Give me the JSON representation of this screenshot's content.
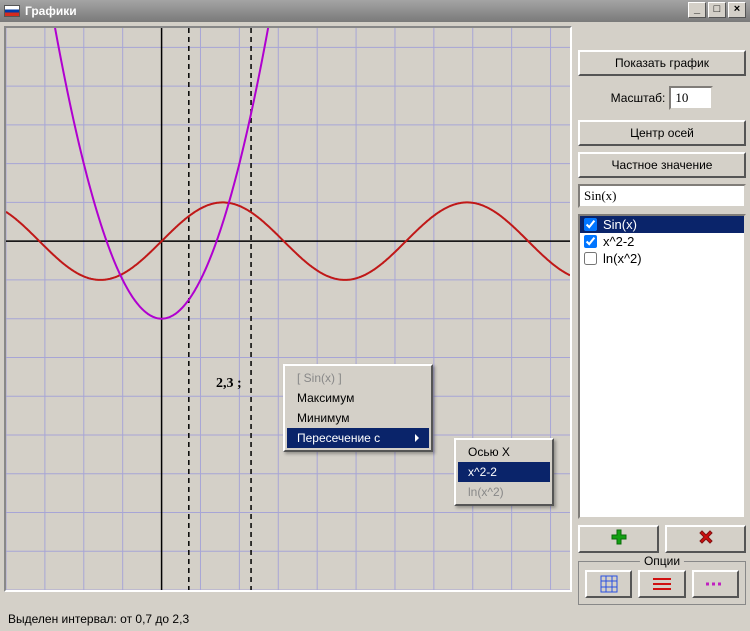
{
  "window": {
    "title": "Графики"
  },
  "chart_data": {
    "type": "line",
    "xlim": [
      -4.0,
      10.5
    ],
    "ylim": [
      -9.0,
      5.5
    ],
    "grid_step": 1,
    "series": [
      {
        "name": "Sin(x)",
        "color": "#c01818",
        "formula": "sin(x)"
      },
      {
        "name": "x^2-2",
        "color": "#b000d0",
        "formula": "x*x-2"
      }
    ],
    "selection": {
      "from": 0.7,
      "to": 2.3
    },
    "cursor_label": "2,3 ;"
  },
  "sidebar": {
    "show_graph": "Показать график",
    "scale_label": "Масштаб:",
    "scale_value": "10",
    "center_axes": "Центр осей",
    "private_value": "Частное значение",
    "fn_input_value": "Sin(x)",
    "add_symbol": "+",
    "del_symbol": "×",
    "options_label": "Опции"
  },
  "fn_list": [
    {
      "label": "Sin(x)",
      "checked": true,
      "selected": true
    },
    {
      "label": "x^2-2",
      "checked": true,
      "selected": false
    },
    {
      "label": "ln(x^2)",
      "checked": false,
      "selected": false
    }
  ],
  "context_menu": {
    "items": [
      {
        "label": "[ Sin(x) ]",
        "disabled": true
      },
      {
        "label": "Максимум"
      },
      {
        "label": "Минимум"
      },
      {
        "label": "Пересечение с",
        "highlight": true,
        "hasarrow": true
      }
    ]
  },
  "submenu": {
    "items": [
      {
        "label": "Осью  X"
      },
      {
        "label": "x^2-2",
        "highlight": true
      },
      {
        "label": "ln(x^2)",
        "disabled": true
      }
    ]
  },
  "statusbar": {
    "text": "Выделен интервал: от 0,7 до 2,3"
  }
}
